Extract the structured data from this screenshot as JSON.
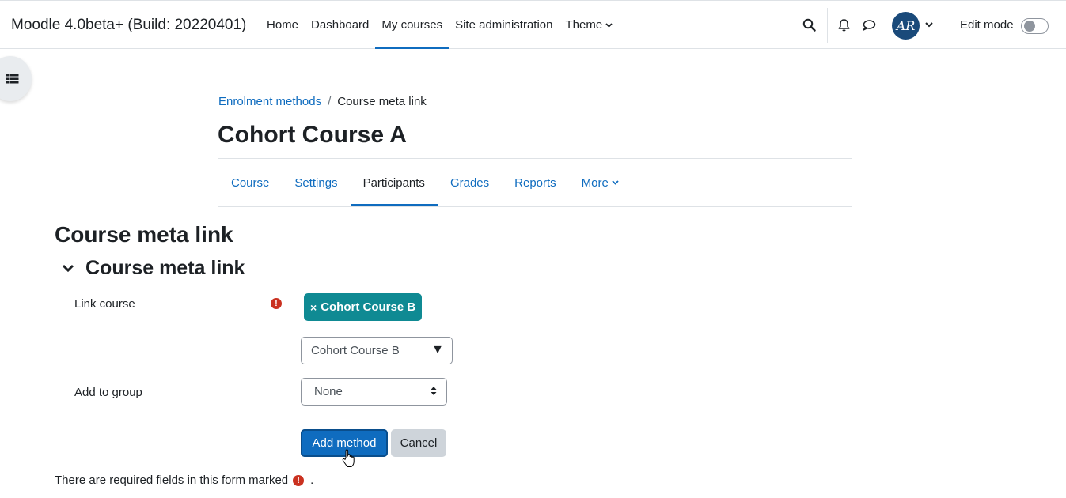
{
  "navbar": {
    "site_name": "Moodle 4.0beta+ (Build: 20220401)",
    "items": [
      {
        "label": "Home"
      },
      {
        "label": "Dashboard"
      },
      {
        "label": "My courses"
      },
      {
        "label": "Site administration"
      },
      {
        "label": "Theme"
      }
    ],
    "active_item": "My courses",
    "avatar_initials": "AR",
    "edit_mode_label": "Edit mode",
    "edit_mode_on": false,
    "icons": [
      "search-icon",
      "bell-icon",
      "chat-icon",
      "chevron-down-icon"
    ]
  },
  "drawer": {
    "icon": "list-icon"
  },
  "breadcrumb": {
    "parent": "Enrolment methods",
    "separator": "/",
    "current": "Course meta link"
  },
  "page_title": "Cohort Course A",
  "secondary_nav": {
    "items": [
      {
        "label": "Course"
      },
      {
        "label": "Settings"
      },
      {
        "label": "Participants"
      },
      {
        "label": "Grades"
      },
      {
        "label": "Reports"
      },
      {
        "label": "More"
      }
    ],
    "active_item": "Participants"
  },
  "form": {
    "heading": "Course meta link",
    "fieldset_title": "Course meta link",
    "link_course_label": "Link course",
    "selected_tag": "Cohort Course B",
    "tag_remove_symbol": "×",
    "link_course_select": "Cohort Course B",
    "add_to_group_label": "Add to group",
    "add_to_group_value": "None",
    "submit_label": "Add method",
    "cancel_label": "Cancel",
    "required_note": "There are required fields in this form marked",
    "required_note_end": "."
  },
  "colors": {
    "primary": "#0f6cbf",
    "tag": "#0f8a93",
    "required": "#ca3120",
    "secondary_button": "#ced4da"
  }
}
